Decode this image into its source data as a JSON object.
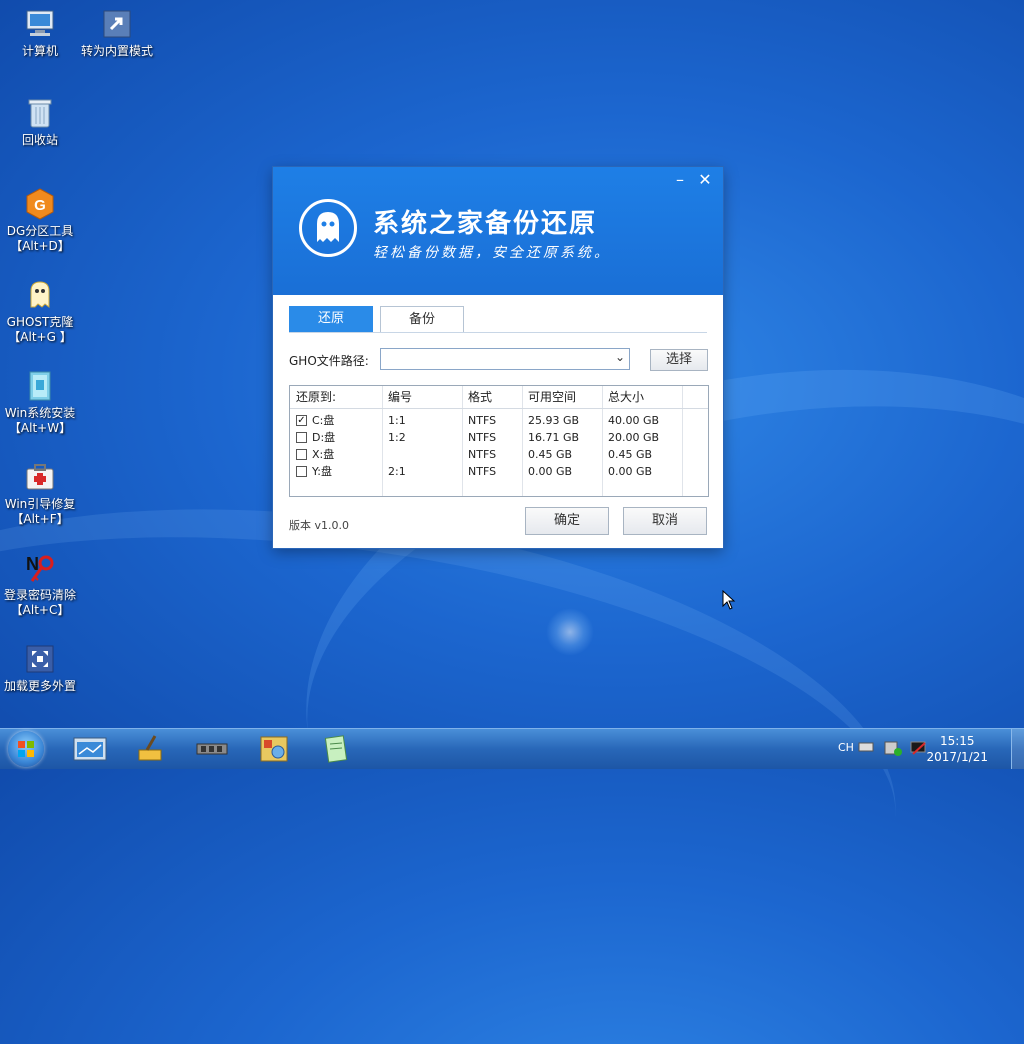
{
  "desktop": {
    "icons": [
      {
        "label": "计算机",
        "icon": "computer-icon"
      },
      {
        "label": "转为内置模式",
        "icon": "shortcut-icon"
      },
      {
        "label": "回收站",
        "icon": "recycle-bin-icon"
      },
      {
        "label": "DG分区工具",
        "sub": "【Alt+D】",
        "icon": "diskgenius-icon"
      },
      {
        "label": "GHOST克隆",
        "sub": "【Alt+G 】",
        "icon": "ghost-icon"
      },
      {
        "label": "Win系统安装",
        "sub": "【Alt+W】",
        "icon": "win-install-icon"
      },
      {
        "label": "Win引导修复",
        "sub": "【Alt+F】",
        "icon": "boot-repair-icon"
      },
      {
        "label": "登录密码清除",
        "sub": "【Alt+C】",
        "icon": "password-clear-icon"
      },
      {
        "label": "加载更多外置",
        "icon": "load-more-icon"
      }
    ]
  },
  "dialog": {
    "title": "系统之家备份还原",
    "subtitle": "轻松备份数据，安全还原系统。",
    "minimize": "–",
    "close": "✕",
    "tabs": [
      {
        "label": "还原",
        "active": true
      },
      {
        "label": "备份",
        "active": false
      }
    ],
    "path_label": "GHO文件路径:",
    "path_value": "",
    "select_button": "选择",
    "table": {
      "headers": [
        "还原到:",
        "编号",
        "格式",
        "可用空间",
        "总大小"
      ],
      "rows": [
        {
          "checked": true,
          "drive": "C:盘",
          "id": "1:1",
          "format": "NTFS",
          "free": "25.93 GB",
          "total": "40.00 GB"
        },
        {
          "checked": false,
          "drive": "D:盘",
          "id": "1:2",
          "format": "NTFS",
          "free": "16.71 GB",
          "total": "20.00 GB"
        },
        {
          "checked": false,
          "drive": "X:盘",
          "id": "",
          "format": "NTFS",
          "free": "0.45 GB",
          "total": "0.45 GB"
        },
        {
          "checked": false,
          "drive": "Y:盘",
          "id": "2:1",
          "format": "NTFS",
          "free": "0.00 GB",
          "total": "0.00 GB"
        }
      ]
    },
    "version": "版本 v1.0.0",
    "ok_button": "确定",
    "cancel_button": "取消"
  },
  "taskbar": {
    "lang": "CH",
    "time": "15:15",
    "date": "2017/1/21"
  },
  "colors": {
    "accent": "#2a8be8",
    "header": "#1e7fe6"
  }
}
